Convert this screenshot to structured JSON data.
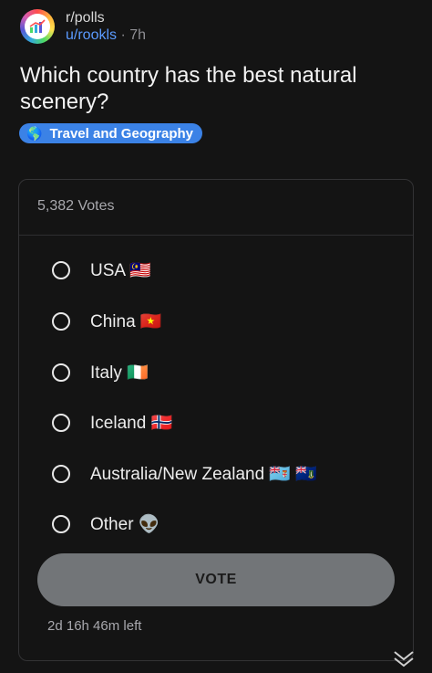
{
  "post": {
    "subreddit": "r/polls",
    "username": "u/rookls",
    "separator": "·",
    "age": "7h",
    "title": "Which country has the best natural scenery?",
    "flair": {
      "icon": "🌎",
      "label": "Travel and Geography",
      "color": "#3b82e6"
    }
  },
  "poll": {
    "votes_text": "5,382 Votes",
    "options": [
      {
        "label": "USA 🇲🇾"
      },
      {
        "label": "China 🇻🇳"
      },
      {
        "label": "Italy 🇮🇪"
      },
      {
        "label": "Iceland 🇳🇴"
      },
      {
        "label": "Australia/New Zealand 🇫🇯 🇻🇬"
      },
      {
        "label": "Other 👽"
      }
    ],
    "vote_button": "VOTE",
    "time_left": "2d 16h 46m left"
  },
  "colors": {
    "background": "#141414",
    "link": "#5b9bff",
    "vote_button": "#727578"
  },
  "icons": {
    "avatar": "poll-chart-icon",
    "expand": "double-chevron-down-icon"
  }
}
